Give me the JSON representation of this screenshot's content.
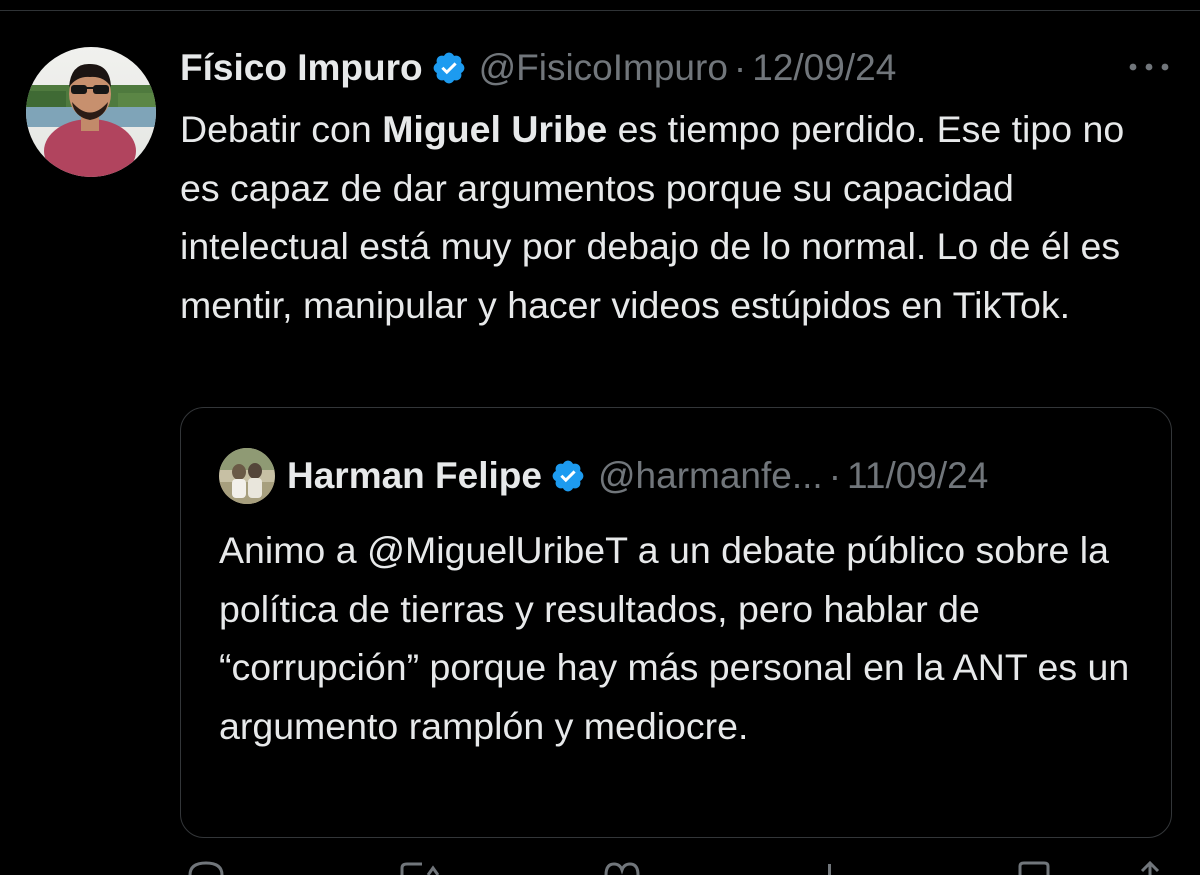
{
  "tweet": {
    "author_name": "Físico Impuro",
    "handle": "@FisicoImpuro",
    "separator": "·",
    "date": "12/09/24",
    "more_label": "···",
    "text_before": "Debatir con ",
    "text_bold": "Miguel Uribe",
    "text_after": " es tiempo perdido. Ese tipo no es capaz de dar argumentos porque su capacidad intelectual está muy por debajo de lo normal. Lo de él es mentir, manipular y hacer videos estúpidos en TikTok."
  },
  "quoted": {
    "author_name": "Harman Felipe",
    "handle": "@harmanfe...",
    "separator": "·",
    "date": "11/09/24",
    "text": "Animo a @MiguelUribeT a un debate público sobre la política de tierras y resultados, pero hablar de “corrupción” porque hay más personal en la ANT es un argumento ramplón y mediocre."
  },
  "actions": {
    "icons": [
      "reply-icon",
      "retweet-icon",
      "like-icon",
      "views-icon",
      "bookmark-icon",
      "share-icon"
    ]
  },
  "colors": {
    "background": "#000000",
    "text_primary": "#e7e9ea",
    "text_secondary": "#71767b",
    "verified_blue": "#1d9bf0",
    "border": "#333639"
  }
}
